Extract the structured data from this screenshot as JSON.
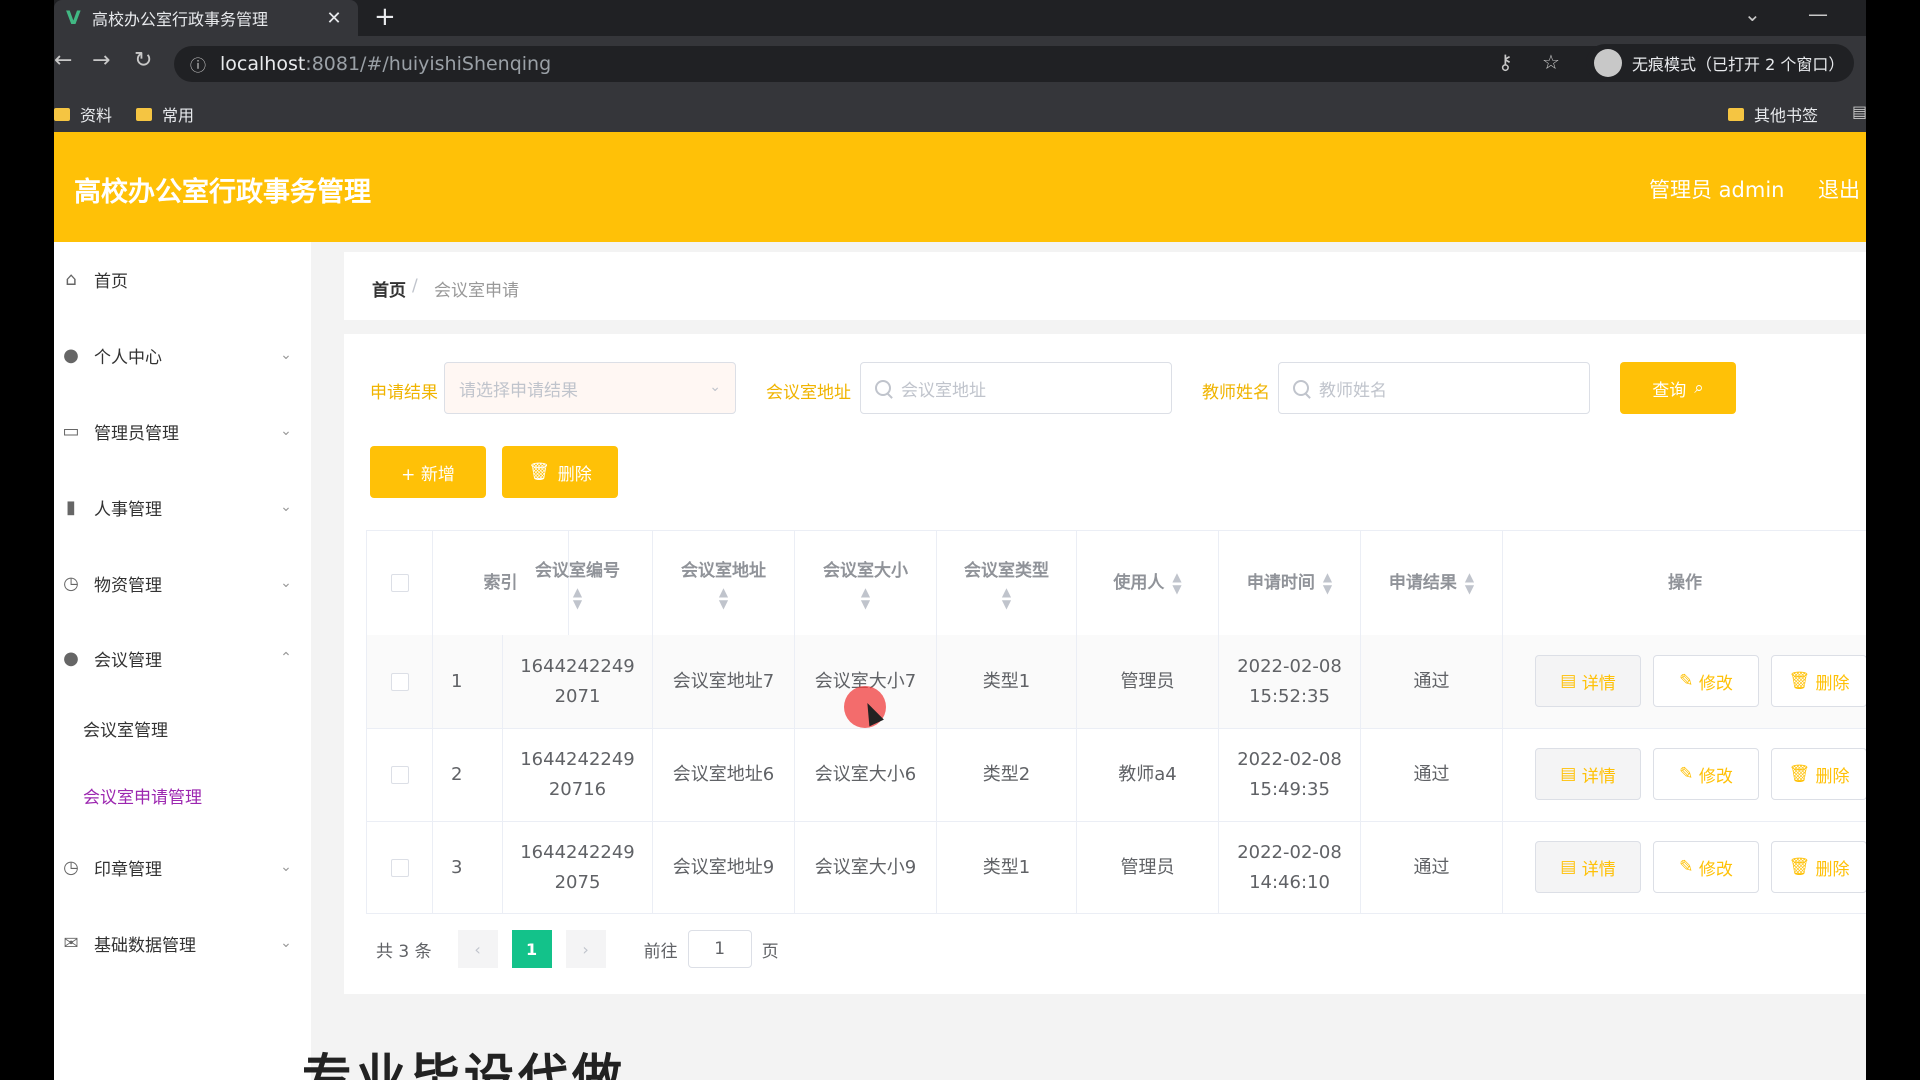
{
  "browser": {
    "tab_logo": "V",
    "tab_title": "高校办公室行政事务管理",
    "url_host": "localhost",
    "url_rest": ":8081/#/huiyishiShenqing",
    "incognito_label": "无痕模式（已打开 2 个窗口）",
    "bookmarks": [
      "资料",
      "常用"
    ],
    "other_bookmarks": "其他书签"
  },
  "header": {
    "title": "高校办公室行政事务管理",
    "admin": "管理员 admin",
    "logout": "退出"
  },
  "sidebar": {
    "items": [
      {
        "label": "首页",
        "icon": "home-icon"
      },
      {
        "label": "个人中心",
        "icon": "user-icon"
      },
      {
        "label": "管理员管理",
        "icon": "id-card-icon"
      },
      {
        "label": "人事管理",
        "icon": "books-icon"
      },
      {
        "label": "物资管理",
        "icon": "compass-icon"
      },
      {
        "label": "会议管理",
        "icon": "pin-icon"
      },
      {
        "label": "印章管理",
        "icon": "compass-icon"
      },
      {
        "label": "基础数据管理",
        "icon": "mail-icon"
      }
    ],
    "sub_items": [
      "会议室管理",
      "会议室申请管理"
    ]
  },
  "breadcrumb": {
    "home": "首页",
    "sep": "/",
    "current": "会议室申请"
  },
  "filters": {
    "result_label": "申请结果",
    "result_placeholder": "请选择申请结果",
    "address_label": "会议室地址",
    "address_placeholder": "会议室地址",
    "teacher_label": "教师姓名",
    "teacher_placeholder": "教师姓名",
    "query_label": "查询"
  },
  "actions": {
    "add_label": "+ 新增",
    "delete_label": "删除"
  },
  "table": {
    "headers": [
      "索引",
      "会议室编号",
      "会议室地址",
      "会议室大小",
      "会议室类型",
      "使用人",
      "申请时间",
      "申请结果",
      "操作"
    ],
    "rows": [
      {
        "index": "1",
        "code_line1": "1644242249",
        "code_line2": "2071",
        "address": "会议室地址7",
        "size": "会议室大小7",
        "type": "类型1",
        "user": "管理员",
        "date": "2022-02-08",
        "time": "15:52:35",
        "result": "通过"
      },
      {
        "index": "2",
        "code_line1": "1644242249",
        "code_line2": "20716",
        "address": "会议室地址6",
        "size": "会议室大小6",
        "type": "类型2",
        "user": "教师a4",
        "date": "2022-02-08",
        "time": "15:49:35",
        "result": "通过"
      },
      {
        "index": "3",
        "code_line1": "1644242249",
        "code_line2": "2075",
        "address": "会议室地址9",
        "size": "会议室大小9",
        "type": "类型1",
        "user": "管理员",
        "date": "2022-02-08",
        "time": "14:46:10",
        "result": "通过"
      }
    ],
    "op_detail": "详情",
    "op_edit": "修改",
    "op_delete": "删除"
  },
  "pager": {
    "total": "共 3 条",
    "current": "1",
    "goto": "前往",
    "goto_value": "1",
    "unit": "页"
  },
  "watermark": "专业毕设代做"
}
